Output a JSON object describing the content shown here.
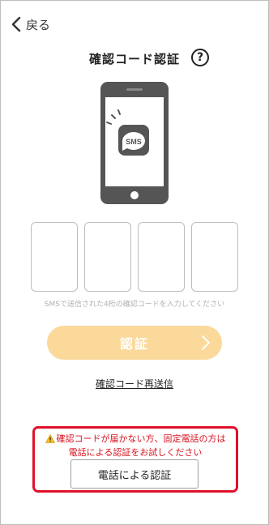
{
  "nav": {
    "back_label": "戻る"
  },
  "header": {
    "title": "確認コード認証",
    "help_glyph": "?"
  },
  "illustration": {
    "badge_text": "SMS"
  },
  "code_input": {
    "digit_count": 4,
    "hint": "SMSで送信された4桁の確認コードを入力してください"
  },
  "actions": {
    "verify_label": "認証",
    "resend_label": "確認コード再送信"
  },
  "notice": {
    "line1": "確認コードが届かない方、固定電話の方は",
    "line2": "電話による認証をお試しください",
    "button_label": "電話による認証"
  },
  "colors": {
    "verify_disabled": "#fad99a",
    "notice_border": "#e0112b",
    "notice_text": "#d6121f"
  }
}
